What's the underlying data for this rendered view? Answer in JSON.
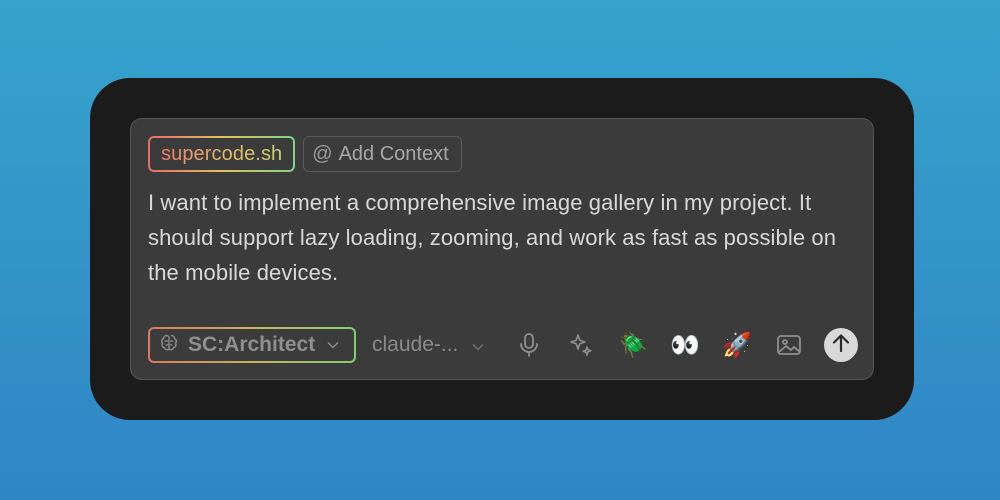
{
  "chips": {
    "brand": "supercode.sh",
    "context_icon": "@",
    "context_label": "Add Context"
  },
  "message": "I want to implement a comprehensive image gallery in my project. It should support lazy loading, zooming, and work as fast as possible on the mobile devices.",
  "toolbar": {
    "mode_label": "SC:Architect",
    "model_label": "claude-...",
    "icons": [
      "brain-icon",
      "chevron-down-icon",
      "microphone-icon",
      "sparkles-icon",
      "bug-icon",
      "eyes-icon",
      "rocket-icon",
      "image-icon",
      "send-arrow-icon"
    ],
    "bug_emoji": "🪲",
    "eyes_emoji": "👀",
    "rocket_emoji": "🚀"
  },
  "colors": {
    "background_top": "#36a3cc",
    "background_bottom": "#2f86c4",
    "frame": "#1b1b1b",
    "panel": "#3b3b3b",
    "text": "#d9d9d9",
    "muted": "#8a8a8a"
  }
}
